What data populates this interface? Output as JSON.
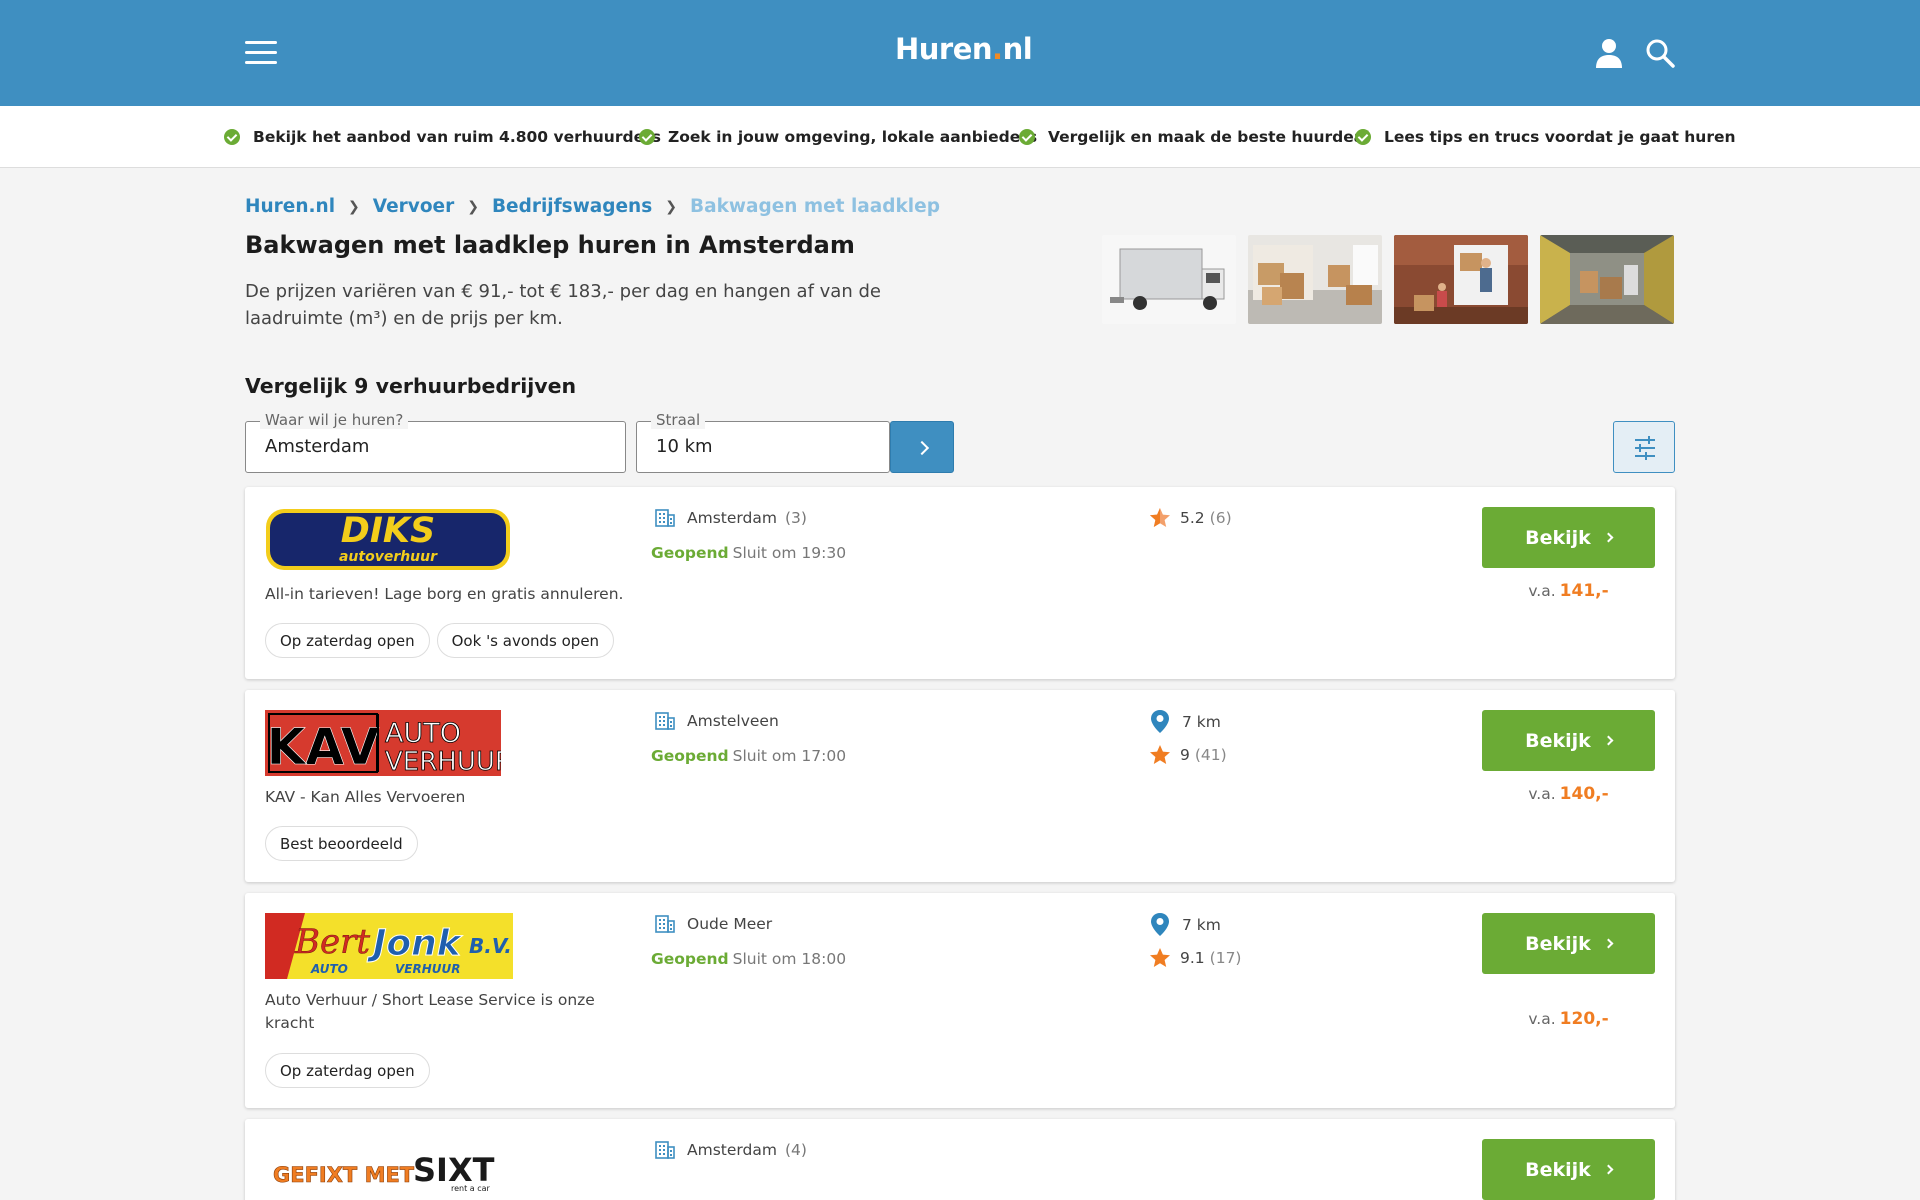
{
  "header": {
    "logo_main": "Huren",
    "logo_dot": ".",
    "logo_tld": "nl",
    "menu_icon": "hamburger-menu-icon",
    "account_icon": "user-icon",
    "search_icon": "search-icon",
    "color": "#3f8fc1"
  },
  "usps": [
    "Bekijk het aanbod van ruim 4.800 verhuurders",
    "Zoek in jouw omgeving, lokale aanbieders",
    "Vergelijk en maak de beste huurdeal",
    "Lees tips en trucs voordat je gaat huren"
  ],
  "breadcrumb": [
    "Huren.nl",
    "Vervoer",
    "Bedrijfswagens",
    "Bakwagen met laadklep"
  ],
  "page": {
    "title": "Bakwagen met laadklep huren in Amsterdam",
    "intro": "De prijzen variëren van € 91,- tot € 183,- per dag en hangen af van de laadruimte (m³) en de prijs per km.",
    "compare_title": "Vergelijk 9 verhuurbedrijven"
  },
  "search": {
    "location_label": "Waar wil je huren?",
    "location_value": "Amsterdam",
    "radius_label": "Straal",
    "radius_value": "10 km"
  },
  "listings": [
    {
      "logo_text": "DIKS",
      "logo_subtext": "autoverhuur",
      "description": "All-in tarieven! Lage borg en gratis annuleren.",
      "tags": [
        "Op zaterdag open",
        "Ook 's avonds open"
      ],
      "location": "Amsterdam",
      "location_count": "(3)",
      "open_label": "Geopend",
      "closes": "Sluit om 19:30",
      "distance": "",
      "rating": "5.2",
      "rating_count": "(6)",
      "button": "Bekijk",
      "price_prefix": "v.a.",
      "price": "141,-"
    },
    {
      "logo_text": "KAV",
      "logo_subtext1": "AUTO",
      "logo_subtext2": "VERHUUR",
      "description": "KAV - Kan Alles Vervoeren",
      "tags": [
        "Best beoordeeld"
      ],
      "location": "Amstelveen",
      "location_count": "",
      "open_label": "Geopend",
      "closes": "Sluit om 17:00",
      "distance": "7 km",
      "rating": "9",
      "rating_count": "(41)",
      "button": "Bekijk",
      "price_prefix": "v.a.",
      "price": "140,-"
    },
    {
      "logo_text1": "Bert",
      "logo_text2": "Jonk",
      "logo_text3": "B.V.",
      "logo_subtext1": "AUTO",
      "logo_subtext2": "VERHUUR",
      "description": "Auto Verhuur / Short Lease Service is onze kracht",
      "tags": [
        "Op zaterdag open"
      ],
      "location": "Oude Meer",
      "location_count": "",
      "open_label": "Geopend",
      "closes": "Sluit om 18:00",
      "distance": "7 km",
      "rating": "9.1",
      "rating_count": "(17)",
      "button": "Bekijk",
      "price_prefix": "v.a.",
      "price": "120,-"
    },
    {
      "logo_text1": "GEFIXT MET",
      "logo_text2": "SIXT",
      "logo_subtext": "rent a car",
      "location": "Amsterdam",
      "location_count": "(4)",
      "button": "Bekijk"
    }
  ],
  "colors": {
    "green": "#6bab35",
    "orange": "#f07d22",
    "blue": "#3f8fc1"
  }
}
